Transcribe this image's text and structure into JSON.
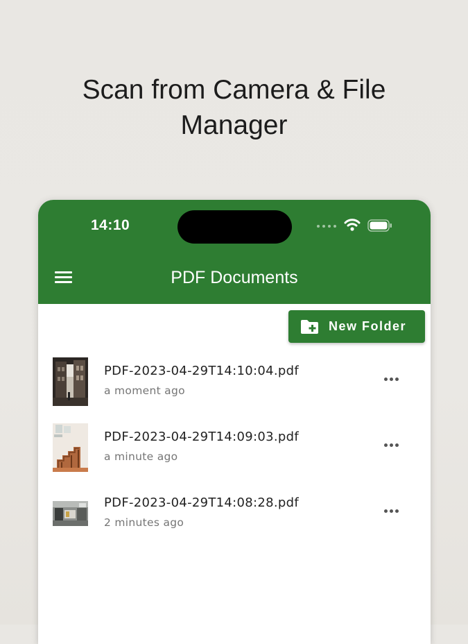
{
  "promo": {
    "headline": "Scan from Camera &  File\nManager"
  },
  "status_bar": {
    "time": "14:10",
    "icons": [
      "cellular-signal-icon",
      "wifi-icon",
      "battery-icon"
    ]
  },
  "app_bar": {
    "title": "PDF Documents",
    "menu_icon": "hamburger-menu-icon",
    "background_color": "#2e7d32"
  },
  "actions": {
    "new_folder_label": "New Folder",
    "new_folder_icon": "folder-plus-icon"
  },
  "files": [
    {
      "name": "PDF-2023-04-29T14:10:04.pdf",
      "modified": "a moment ago",
      "thumbnail": "street-photo-thumbnail"
    },
    {
      "name": "PDF-2023-04-29T14:09:03.pdf",
      "modified": "a minute ago",
      "thumbnail": "staircase-photo-thumbnail"
    },
    {
      "name": "PDF-2023-04-29T14:08:28.pdf",
      "modified": "2 minutes ago",
      "thumbnail": "room-photo-thumbnail"
    }
  ],
  "colors": {
    "accent": "#2e7d32",
    "text_primary": "#222222",
    "text_secondary": "#757575"
  }
}
